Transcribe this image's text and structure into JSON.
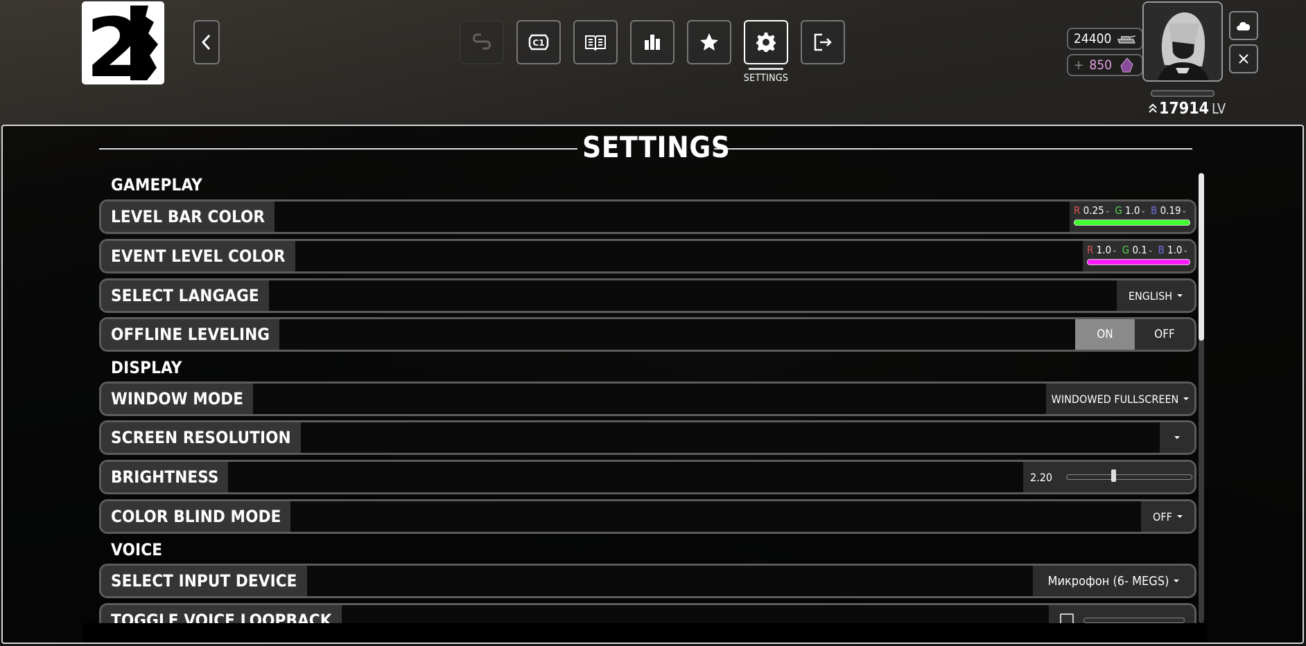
{
  "header": {
    "logo_text": "2",
    "nav": [
      {
        "name": "link-icon",
        "label": ""
      },
      {
        "name": "c1-icon",
        "label": "C1"
      },
      {
        "name": "book-icon",
        "label": ""
      },
      {
        "name": "bar-chart-icon",
        "label": ""
      },
      {
        "name": "star-icon",
        "label": ""
      },
      {
        "name": "gear-icon",
        "label": ""
      },
      {
        "name": "logout-icon",
        "label": ""
      }
    ],
    "active_nav_label": "SETTINGS",
    "currency_primary": "24400",
    "currency_secondary": "850",
    "currency_secondary_prefix": "+",
    "level_value": "17914",
    "level_unit": "LV"
  },
  "page": {
    "title": "SETTINGS"
  },
  "sections": {
    "gameplay": "GAMEPLAY",
    "display": "DISPLAY",
    "voice": "VOICE"
  },
  "settings": {
    "level_bar_color": {
      "label": "LEVEL BAR COLOR",
      "r": "0.25",
      "g": "1.0",
      "b": "0.19",
      "color": "#40ff30"
    },
    "event_level_color": {
      "label": "EVENT LEVEL COLOR",
      "r": "1.0",
      "g": "0.1",
      "b": "1.0",
      "color": "#ff1aff"
    },
    "select_language": {
      "label": "SELECT LANGAGE",
      "value": "ENGLISH"
    },
    "offline_leveling": {
      "label": "OFFLINE LEVELING",
      "on": "ON",
      "off": "OFF",
      "selected": "ON"
    },
    "window_mode": {
      "label": "WINDOW MODE",
      "value": "WINDOWED FULLSCREEN"
    },
    "screen_resolution": {
      "label": "SCREEN RESOLUTION",
      "value": ""
    },
    "brightness": {
      "label": "BRIGHTNESS",
      "value": "2.20",
      "fraction": 0.37
    },
    "color_blind_mode": {
      "label": "COLOR BLIND MODE",
      "value": "OFF"
    },
    "select_input_device": {
      "label": "SELECT INPUT DEVICE",
      "value": "Микрофон (6- MEGS)"
    },
    "toggle_voice_loopback": {
      "label": "TOGGLE VOICE LOOPBACK"
    }
  },
  "colors": {
    "accent_red": "#e05555",
    "accent_green": "#55d355",
    "accent_blue": "#7070e0",
    "currency_pink": "#e0a0e0"
  }
}
